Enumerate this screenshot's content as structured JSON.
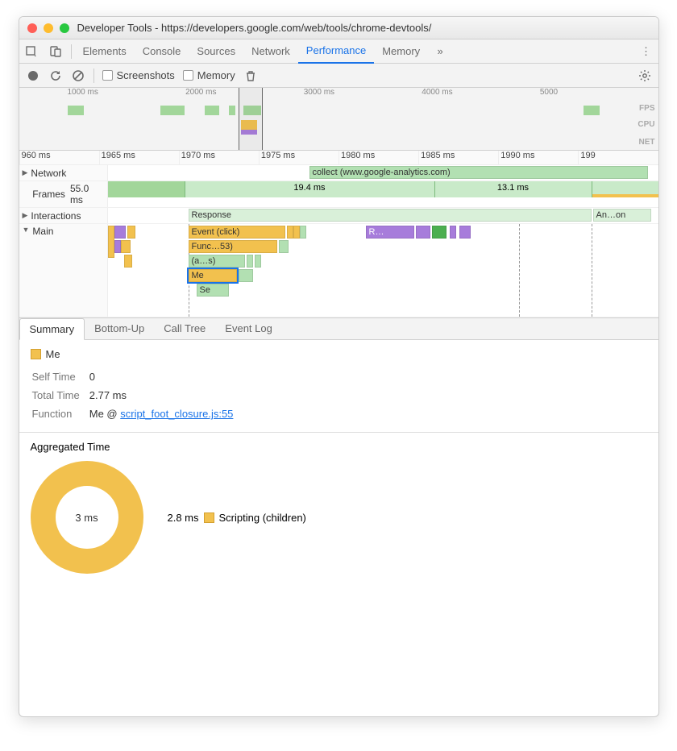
{
  "window": {
    "title": "Developer Tools - https://developers.google.com/web/tools/chrome-devtools/"
  },
  "tabs": {
    "items": [
      "Elements",
      "Console",
      "Sources",
      "Network",
      "Performance",
      "Memory"
    ],
    "active": "Performance"
  },
  "toolbar": {
    "screenshots_label": "Screenshots",
    "memory_label": "Memory"
  },
  "overview": {
    "ticks": [
      "1000 ms",
      "2000 ms",
      "3000 ms",
      "4000 ms",
      "5000"
    ],
    "labels": {
      "fps": "FPS",
      "cpu": "CPU",
      "net": "NET"
    }
  },
  "ruler": [
    "960 ms",
    "1965 ms",
    "1970 ms",
    "1975 ms",
    "1980 ms",
    "1985 ms",
    "1990 ms",
    "199"
  ],
  "tracks": {
    "network": {
      "label": "Network",
      "item": "collect (www.google-analytics.com)"
    },
    "frames": {
      "label": "Frames",
      "total": "55.0 ms",
      "slices": [
        "19.4 ms",
        "13.1 ms"
      ]
    },
    "interactions": {
      "label": "Interactions",
      "left": "Response",
      "right": "An…on"
    },
    "main": {
      "label": "Main",
      "events": {
        "event_click": "Event (click)",
        "func": "Func…53)",
        "anon": "(a…s)",
        "me": "Me",
        "se": "Se",
        "r": "R…"
      }
    }
  },
  "detail_tabs": [
    "Summary",
    "Bottom-Up",
    "Call Tree",
    "Event Log"
  ],
  "summary": {
    "title": "Me",
    "self_time_label": "Self Time",
    "self_time": "0",
    "total_time_label": "Total Time",
    "total_time": "2.77 ms",
    "function_label": "Function",
    "function_prefix": "Me @ ",
    "function_link": "script_foot_closure.js:55"
  },
  "aggregated": {
    "title": "Aggregated Time",
    "center": "3 ms",
    "legend_value": "2.8 ms",
    "legend_label": "Scripting (children)"
  },
  "chart_data": {
    "type": "pie",
    "title": "Aggregated Time",
    "total": "3 ms",
    "series": [
      {
        "name": "Scripting (children)",
        "value": 2.8,
        "unit": "ms",
        "color": "#f2c14e"
      }
    ]
  }
}
